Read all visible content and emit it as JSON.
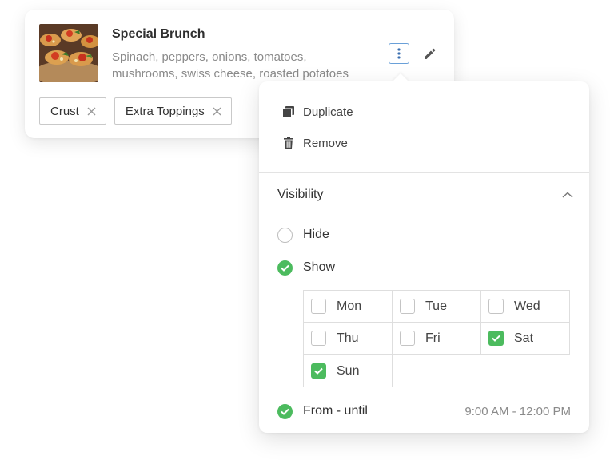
{
  "item": {
    "title": "Special Brunch",
    "description": "Spinach, peppers, onions, tomatoes, mushrooms, swiss cheese, roasted potatoes",
    "image_icon": "food-photo",
    "tags": [
      {
        "label": "Crust"
      },
      {
        "label": "Extra Toppings"
      }
    ]
  },
  "menu": {
    "duplicate_label": "Duplicate",
    "remove_label": "Remove"
  },
  "visibility": {
    "title": "Visibility",
    "expanded": true,
    "options": [
      {
        "label": "Hide",
        "selected": false
      },
      {
        "label": "Show",
        "selected": true
      }
    ],
    "days": [
      {
        "label": "Mon",
        "checked": false
      },
      {
        "label": "Tue",
        "checked": false
      },
      {
        "label": "Wed",
        "checked": false
      },
      {
        "label": "Thu",
        "checked": false
      },
      {
        "label": "Fri",
        "checked": false
      },
      {
        "label": "Sat",
        "checked": true
      },
      {
        "label": "Sun",
        "checked": true
      }
    ],
    "time": {
      "label": "From - until",
      "enabled": true,
      "range": "9:00 AM - 12:00 PM"
    }
  },
  "colors": {
    "accent_green": "#4cbb5e",
    "focus_blue": "#6aa0d8",
    "muted_text": "#8a8a8a"
  }
}
